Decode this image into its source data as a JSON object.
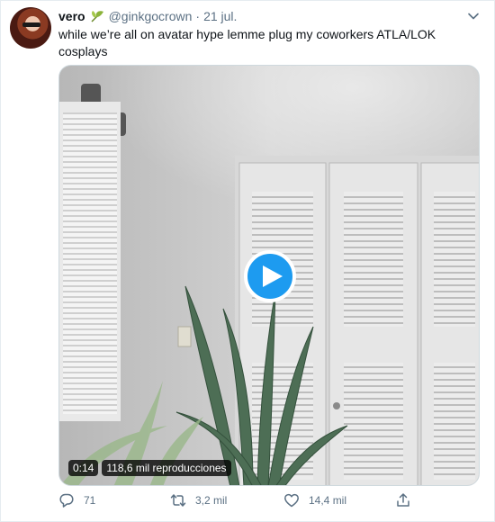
{
  "tweet": {
    "author_name": "vero",
    "handle": "@ginkgocrown",
    "separator": "·",
    "date": "21 jul.",
    "text": "while we’re all on avatar hype lemme plug my coworkers ATLA/LOK cosplays"
  },
  "video": {
    "time": "0:14",
    "views": "118,6 mil reproducciones"
  },
  "actions": {
    "replies": "71",
    "retweets": "3,2 mil",
    "likes": "14,4 mil"
  },
  "colors": {
    "accent": "#1d9bf0",
    "muted_text": "#5b7083",
    "border": "#e6ecf0"
  },
  "icons": [
    "ginkgo-leaf-icon",
    "chevron-down-icon",
    "play-icon",
    "reply-icon",
    "retweet-icon",
    "like-icon",
    "share-icon"
  ]
}
